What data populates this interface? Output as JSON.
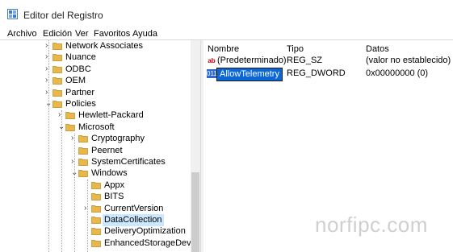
{
  "window": {
    "title": "Editor del Registro"
  },
  "menu": [
    "Archivo",
    "Edición",
    "Ver",
    "Favoritos",
    "Ayuda"
  ],
  "tree": [
    {
      "label": "Network Associates",
      "exp": "›",
      "level": 1
    },
    {
      "label": "Nuance",
      "exp": "›",
      "level": 1
    },
    {
      "label": "ODBC",
      "exp": "›",
      "level": 1
    },
    {
      "label": "OEM",
      "exp": "›",
      "level": 1
    },
    {
      "label": "Partner",
      "exp": "›",
      "level": 1
    },
    {
      "label": "Policies",
      "exp": "⌄",
      "level": 1
    },
    {
      "label": "Hewlett-Packard",
      "exp": "›",
      "level": 2
    },
    {
      "label": "Microsoft",
      "exp": "⌄",
      "level": 2
    },
    {
      "label": "Cryptography",
      "exp": "›",
      "level": 3
    },
    {
      "label": "Peernet",
      "exp": "",
      "level": 3
    },
    {
      "label": "SystemCertificates",
      "exp": "›",
      "level": 3
    },
    {
      "label": "Windows",
      "exp": "⌄",
      "level": 3
    },
    {
      "label": "Appx",
      "exp": "",
      "level": 4
    },
    {
      "label": "BITS",
      "exp": "",
      "level": 4
    },
    {
      "label": "CurrentVersion",
      "exp": "›",
      "level": 4
    },
    {
      "label": "DataCollection",
      "exp": "",
      "level": 4,
      "selected": true
    },
    {
      "label": "DeliveryOptimization",
      "exp": "",
      "level": 4
    },
    {
      "label": "EnhancedStorageDevice",
      "exp": "",
      "level": 4
    }
  ],
  "columns": {
    "name": "Nombre",
    "type": "Tipo",
    "data": "Datos"
  },
  "values": [
    {
      "name": "(Predeterminado)",
      "type": "REG_SZ",
      "data": "(valor no establecido)",
      "icon": "ab"
    },
    {
      "name": "AllowTelemetry",
      "type": "REG_DWORD",
      "data": "0x00000000 (0)",
      "icon": "011"
    }
  ],
  "watermark": "norfipc.com",
  "colors": {
    "selection": "#0b66d8",
    "tree_selected": "#cce8ff",
    "folder": "#e8b84a"
  }
}
